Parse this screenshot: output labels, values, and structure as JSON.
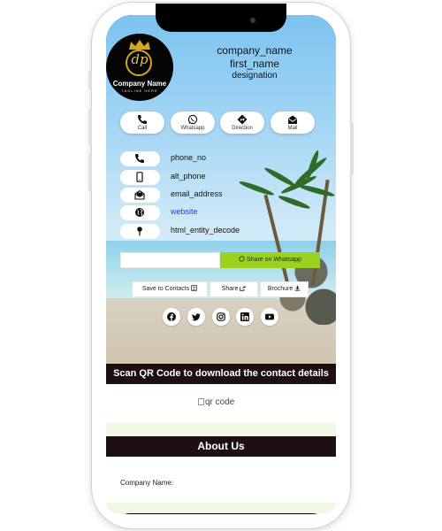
{
  "header": {
    "logo_company_name": "Company Name",
    "logo_tagline": "TAGLINE HERE",
    "company": "company_name",
    "first_name": "first_name",
    "designation": "designation"
  },
  "quick_actions": [
    {
      "label": "Call",
      "icon": "phone-icon"
    },
    {
      "label": "Whatsapp",
      "icon": "whatsapp-icon"
    },
    {
      "label": "Direction",
      "icon": "direction-icon"
    },
    {
      "label": "Mail",
      "icon": "mail-icon"
    }
  ],
  "contacts": [
    {
      "text": "phone_no",
      "icon": "phone-icon",
      "link": false
    },
    {
      "text": "alt_phone",
      "icon": "mobile-icon",
      "link": false
    },
    {
      "text": "email_address",
      "icon": "envelope-open-icon",
      "link": false
    },
    {
      "text": "website",
      "icon": "globe-icon",
      "link": true
    },
    {
      "text": "html_entity_decode",
      "icon": "map-pin-icon",
      "link": false
    }
  ],
  "whatsapp_share": {
    "button_label": "Share on Whatsapp"
  },
  "actions": {
    "save_contacts": "Save to Contacts",
    "share": "Share",
    "brochure": "Brochure"
  },
  "social": [
    "facebook-icon",
    "twitter-icon",
    "instagram-icon",
    "linkedin-icon",
    "youtube-icon"
  ],
  "qr_section": {
    "heading": "Scan QR Code to download the contact details",
    "image_alt": "qr code"
  },
  "about": {
    "heading": "About Us",
    "company_name_label": "Company Name:"
  },
  "colors": {
    "accent_green": "#9bd21f",
    "dark_bar": "#1d0f12",
    "link_blue": "#1a3cff"
  }
}
